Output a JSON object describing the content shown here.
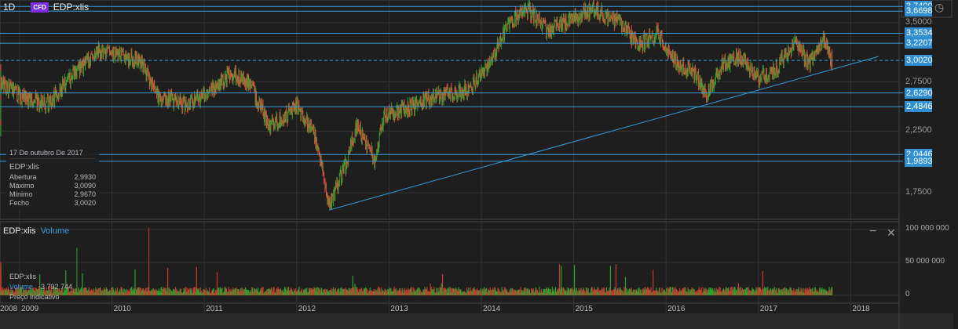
{
  "header": {
    "interval": "1D",
    "badge": "CFD",
    "symbol": "EDP:xlis"
  },
  "price_levels": [
    {
      "label": "3,7400",
      "value": 3.74
    },
    {
      "label": "3,6698",
      "value": 3.6698
    },
    {
      "label": "3,3534",
      "value": 3.3534
    },
    {
      "label": "3,2207",
      "value": 3.2207
    },
    {
      "label": "3,0020",
      "value": 3.002,
      "dashed": true
    },
    {
      "label": "2,6290",
      "value": 2.629
    },
    {
      "label": "2,4846",
      "value": 2.4846
    },
    {
      "label": "2,0446",
      "value": 2.0446
    },
    {
      "label": "1,9893",
      "value": 1.9893
    }
  ],
  "price_axis": [
    {
      "label": "3,5000",
      "value": 3.5
    },
    {
      "label": "2,7500",
      "value": 2.75
    },
    {
      "label": "2,2500",
      "value": 2.25
    },
    {
      "label": "1,7500",
      "value": 1.75
    }
  ],
  "tooltip": {
    "date": "17 De outubro De 2017",
    "symbol": "EDP:xlis",
    "rows": [
      {
        "label": "Abertura",
        "value": "2,9930"
      },
      {
        "label": "Máximo",
        "value": "3,0090"
      },
      {
        "label": "Mínimo",
        "value": "2,9670"
      },
      {
        "label": "Fecho",
        "value": "3,0020"
      }
    ]
  },
  "volume_pane": {
    "symbol": "EDP:xlis",
    "indicator": "Volume",
    "info_symbol": "EDP:xlis",
    "info_label": "Volume",
    "info_value": "3 792 744",
    "note": "Preço indicativo",
    "axis": [
      {
        "label": "100 000 000",
        "value": 100000000
      },
      {
        "label": "50 000 000",
        "value": 50000000
      },
      {
        "label": "0",
        "value": 0
      }
    ],
    "minimize": "−",
    "close": "✕"
  },
  "years": [
    "2008",
    "2009",
    "2010",
    "2011",
    "2012",
    "2013",
    "2014",
    "2015",
    "2016",
    "2017",
    "2018"
  ],
  "chart_data": {
    "type": "candlestick",
    "scale": "log",
    "ylim": [
      1.6,
      3.8
    ],
    "anchors": [
      [
        2008.0,
        2.9
      ],
      [
        2008.1,
        2.3
      ],
      [
        2008.4,
        2.6
      ],
      [
        2008.7,
        2.8
      ],
      [
        2009.0,
        2.6
      ],
      [
        2009.3,
        2.5
      ],
      [
        2009.6,
        2.85
      ],
      [
        2009.85,
        3.1
      ],
      [
        2010.0,
        3.1
      ],
      [
        2010.3,
        3.0
      ],
      [
        2010.5,
        2.6
      ],
      [
        2010.8,
        2.5
      ],
      [
        2011.0,
        2.6
      ],
      [
        2011.3,
        2.85
      ],
      [
        2011.5,
        2.7
      ],
      [
        2011.7,
        2.3
      ],
      [
        2011.9,
        2.4
      ],
      [
        2012.0,
        2.5
      ],
      [
        2012.2,
        2.2
      ],
      [
        2012.35,
        1.65
      ],
      [
        2012.55,
        2.0
      ],
      [
        2012.65,
        2.3
      ],
      [
        2012.85,
        2.0
      ],
      [
        2012.95,
        2.4
      ],
      [
        2013.3,
        2.5
      ],
      [
        2013.5,
        2.6
      ],
      [
        2013.8,
        2.65
      ],
      [
        2013.9,
        2.7
      ],
      [
        2014.1,
        3.0
      ],
      [
        2014.3,
        3.5
      ],
      [
        2014.5,
        3.7
      ],
      [
        2014.7,
        3.4
      ],
      [
        2015.0,
        3.55
      ],
      [
        2015.2,
        3.7
      ],
      [
        2015.5,
        3.5
      ],
      [
        2015.7,
        3.2
      ],
      [
        2015.9,
        3.35
      ],
      [
        2016.1,
        3.0
      ],
      [
        2016.3,
        2.85
      ],
      [
        2016.45,
        2.6
      ],
      [
        2016.6,
        2.95
      ],
      [
        2016.8,
        3.05
      ],
      [
        2017.0,
        2.8
      ],
      [
        2017.2,
        2.9
      ],
      [
        2017.4,
        3.25
      ],
      [
        2017.55,
        2.95
      ],
      [
        2017.7,
        3.25
      ],
      [
        2017.8,
        3.0
      ]
    ],
    "trendline": [
      [
        2012.35,
        1.63
      ],
      [
        2018.3,
        3.05
      ]
    ],
    "last_close": 3.002,
    "last_volume": 3792744
  }
}
